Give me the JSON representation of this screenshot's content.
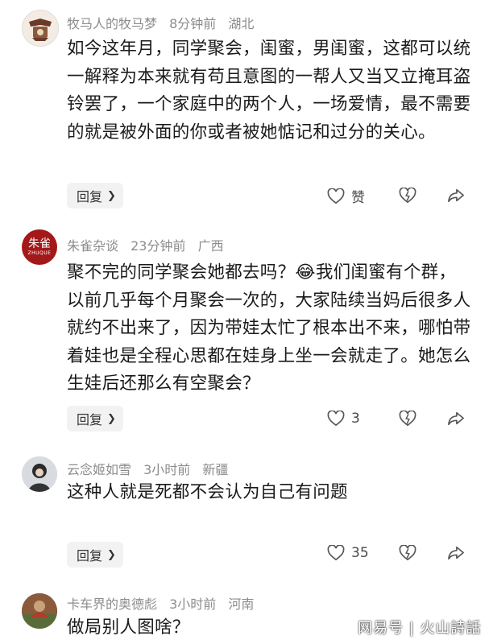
{
  "comments": [
    {
      "username": "牧马人的牧马梦",
      "time": "8分钟前",
      "location": "湖北",
      "text": "如今这年月，同学聚会，闺蜜，男闺蜜，这都可以统一解释为本来就有苟且意图的一帮人又当又立掩耳盗铃罢了，一个家庭中的两个人，一场爱情，最不需要的就是被外面的你或者被她惦记和过分的关心。",
      "reply_label": "回复",
      "like_label": "赞"
    },
    {
      "username": "朱雀杂谈",
      "avatar_text": "朱雀",
      "avatar_subtext": "ZHUQUE",
      "time": "23分钟前",
      "location": "广西",
      "text_before_emoji": "聚不完的同学聚会她都去吗？",
      "emoji": "😂",
      "text_after_emoji": "我们闺蜜有个群，以前几乎每个月聚会一次的，大家陆续当妈后很多人就约不出来了，因为带娃太忙了根本出不来，哪怕带着娃也是全程心思都在娃身上坐一会就走了。她怎么生娃后还那么有空聚会？",
      "reply_label": "回复",
      "like_label": "3"
    },
    {
      "username": "云念姬如雪",
      "time": "3小时前",
      "location": "新疆",
      "text": "这种人就是死都不会认为自己有问题",
      "reply_label": "回复",
      "like_label": "35"
    },
    {
      "username": "卡车界的奥德彪",
      "time": "3小时前",
      "location": "河南",
      "text": "做局别人图啥？"
    }
  ],
  "watermark": "网易号 | 火山詩話",
  "icons": [
    "like-icon",
    "dislike-icon",
    "share-icon",
    "chevron-right-icon"
  ],
  "colors": {
    "meta": "#8c8c8c",
    "text": "#1a1a1a",
    "reply_bg": "#f2f2f2"
  }
}
